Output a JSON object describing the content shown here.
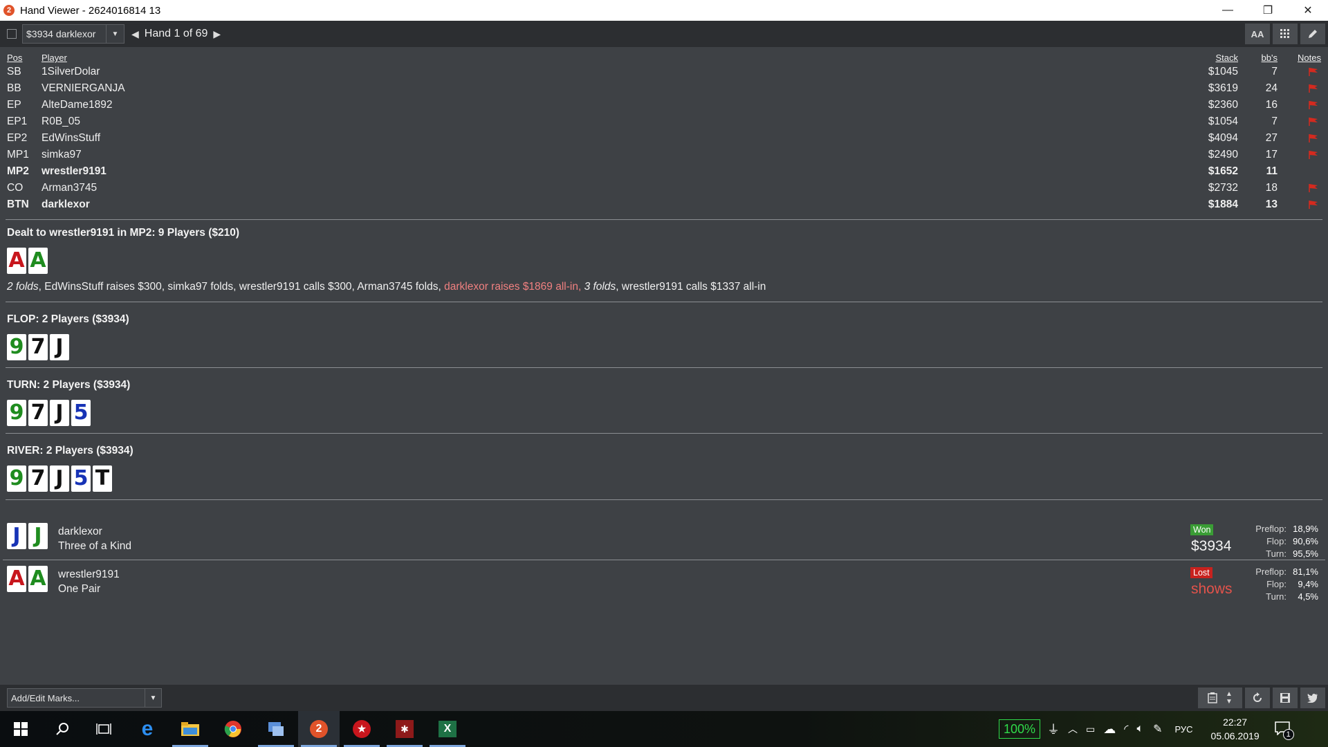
{
  "window": {
    "title": "Hand Viewer - 2624016814 13",
    "minimize": "—",
    "restore": "❐",
    "close": "✕"
  },
  "toolbar": {
    "player_select": "$3934 darklexor",
    "hand_label": "Hand 1 of 69",
    "aa_label": "AA"
  },
  "table": {
    "headers": {
      "pos": "Pos",
      "player": "Player",
      "stack": "Stack",
      "bbs": "bb's",
      "notes": "Notes"
    },
    "rows": [
      {
        "pos": "SB",
        "player": "1SilverDolar",
        "stack": "$1045",
        "bbs": "7",
        "bold": false,
        "flag": true
      },
      {
        "pos": "BB",
        "player": "VERNIERGANJA",
        "stack": "$3619",
        "bbs": "24",
        "bold": false,
        "flag": true
      },
      {
        "pos": "EP",
        "player": "AlteDame1892",
        "stack": "$2360",
        "bbs": "16",
        "bold": false,
        "flag": true
      },
      {
        "pos": "EP1",
        "player": "R0B_05",
        "stack": "$1054",
        "bbs": "7",
        "bold": false,
        "flag": true
      },
      {
        "pos": "EP2",
        "player": "EdWinsStuff",
        "stack": "$4094",
        "bbs": "27",
        "bold": false,
        "flag": true
      },
      {
        "pos": "MP1",
        "player": "simka97",
        "stack": "$2490",
        "bbs": "17",
        "bold": false,
        "flag": true
      },
      {
        "pos": "MP2",
        "player": "wrestler9191",
        "stack": "$1652",
        "bbs": "11",
        "bold": true,
        "flag": false
      },
      {
        "pos": "CO",
        "player": "Arman3745",
        "stack": "$2732",
        "bbs": "18",
        "bold": false,
        "flag": true
      },
      {
        "pos": "BTN",
        "player": "darklexor",
        "stack": "$1884",
        "bbs": "13",
        "bold": true,
        "flag": true
      }
    ]
  },
  "preflop": {
    "title": "Dealt to wrestler9191 in MP2: 9 Players ($210)",
    "cards": [
      "A",
      "A"
    ],
    "actions": {
      "a1": "2 folds",
      "a2": ", EdWinsStuff raises $300, simka97 folds, wrestler9191 calls $300, Arman3745 folds, ",
      "a3": "darklexor raises $1869 all-in,",
      "a4": " ",
      "a5": "3 folds",
      "a6": ", wrestler9191 calls $1337 all-in"
    }
  },
  "flop": {
    "title": "FLOP: 2 Players ($3934)",
    "cards": [
      "9",
      "7",
      "J"
    ]
  },
  "turn": {
    "title": "TURN: 2 Players ($3934)",
    "cards": [
      "9",
      "7",
      "J",
      "5"
    ]
  },
  "river": {
    "title": "RIVER: 2 Players ($3934)",
    "cards": [
      "9",
      "7",
      "J",
      "5",
      "T"
    ]
  },
  "results": [
    {
      "cards": [
        "J",
        "J"
      ],
      "name": "darklexor",
      "hand": "Three of a Kind",
      "badge": "Won",
      "amount": "$3934",
      "equity": [
        {
          "label": "Preflop:",
          "value": "18,9%"
        },
        {
          "label": "Flop:",
          "value": "90,6%"
        },
        {
          "label": "Turn:",
          "value": "95,5%"
        }
      ]
    },
    {
      "cards": [
        "A",
        "A"
      ],
      "name": "wrestler9191",
      "hand": "One Pair",
      "badge": "Lost",
      "amount": "shows",
      "equity": [
        {
          "label": "Preflop:",
          "value": "81,1%"
        },
        {
          "label": "Flop:",
          "value": "9,4%"
        },
        {
          "label": "Turn:",
          "value": "4,5%"
        }
      ]
    }
  ],
  "bottom": {
    "marks_placeholder": "Add/Edit Marks..."
  },
  "taskbar": {
    "battery": "100%",
    "lang": "РУС",
    "time": "22:27",
    "date": "05.06.2019",
    "notif_count": "1"
  },
  "colors": {
    "background": "#3e4145",
    "toolbar": "#2c2e31",
    "highlight_action": "#f08080",
    "won": "#3a9d35",
    "lost": "#c8221e",
    "flag": "#d42a1f",
    "card_red": "#c8161d",
    "card_green": "#1f8c1f",
    "card_blue": "#1733b6",
    "card_black": "#111111"
  }
}
